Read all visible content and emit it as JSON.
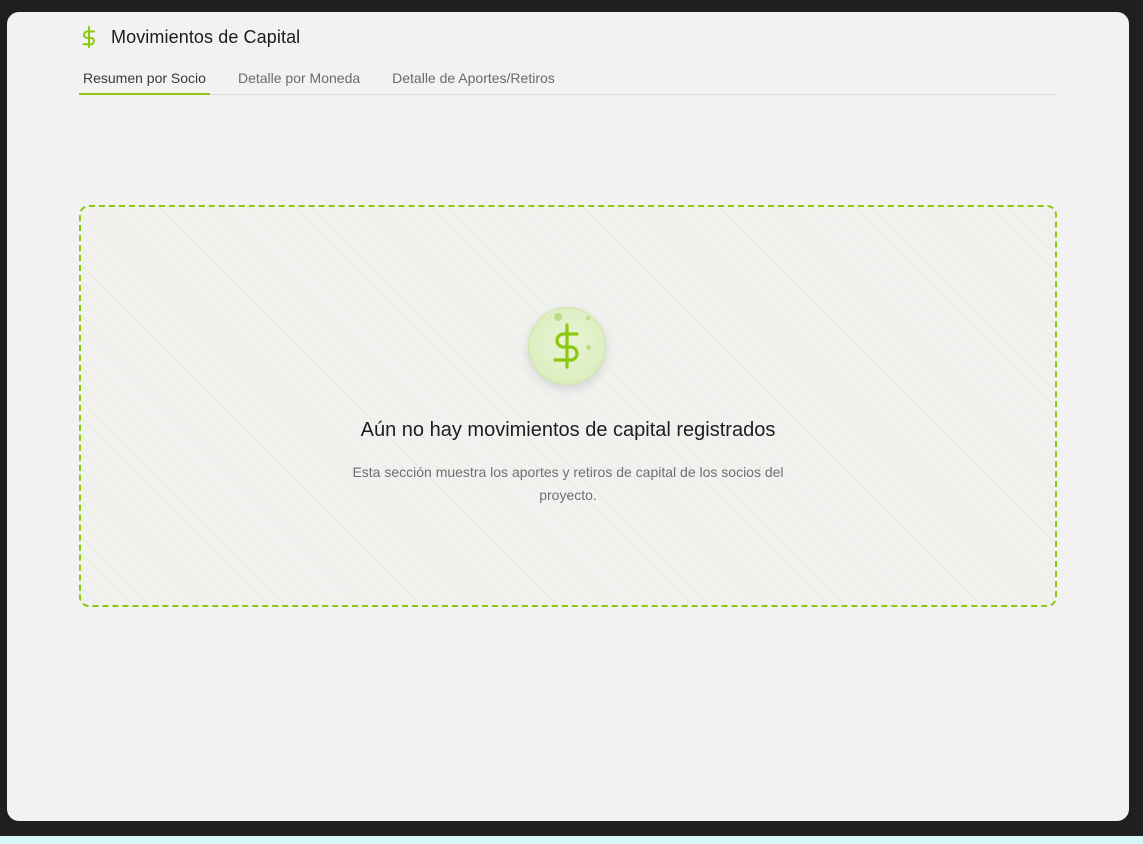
{
  "header": {
    "title": "Movimientos de Capital",
    "icon": "dollar-sign-icon"
  },
  "tabs": [
    {
      "label": "Resumen por Socio",
      "active": true
    },
    {
      "label": "Detalle por Moneda",
      "active": false
    },
    {
      "label": "Detalle de Aportes/Retiros",
      "active": false
    }
  ],
  "empty_state": {
    "icon": "dollar-sign-icon",
    "title": "Aún no hay movimientos de capital registrados",
    "description": "Esta sección muestra los aportes y retiros de capital de los socios del proyecto."
  },
  "colors": {
    "accent": "#8cc90d",
    "panel_bg": "#f2f2f2",
    "frame_bg": "#1f1f21"
  }
}
